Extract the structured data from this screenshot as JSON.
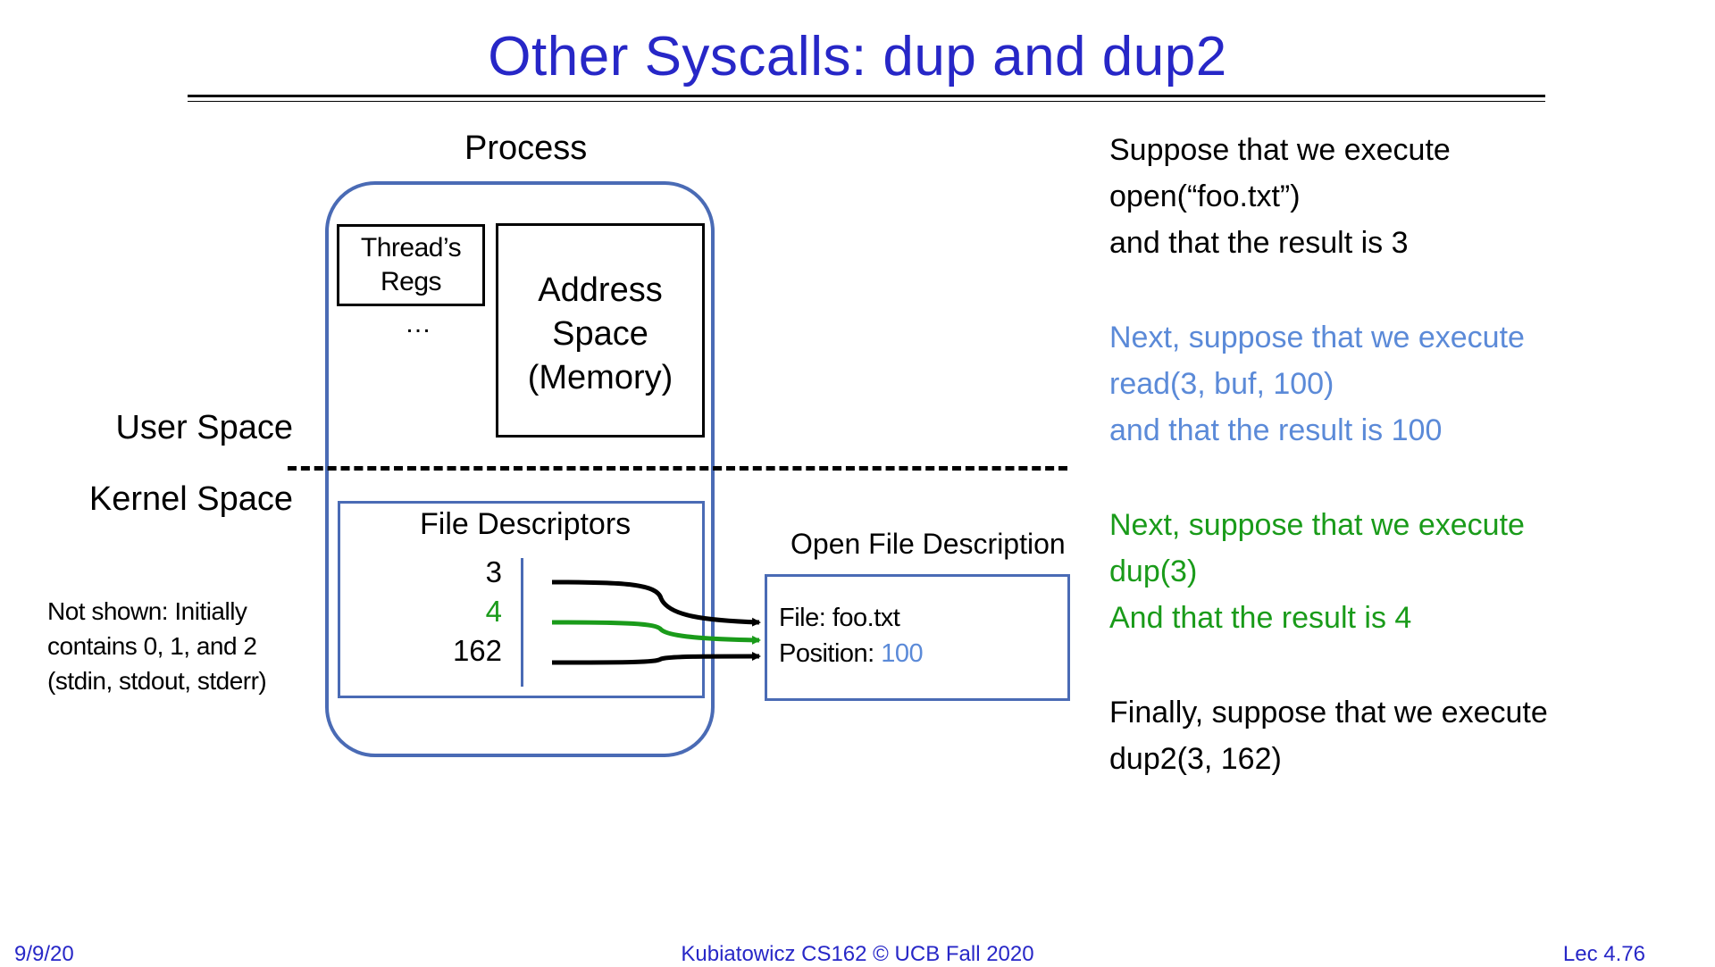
{
  "title": "Other Syscalls: dup and dup2",
  "diagram": {
    "process_label": "Process",
    "user_space_label": "User Space",
    "kernel_space_label": "Kernel Space",
    "threads_regs": [
      "Thread’s",
      "Regs"
    ],
    "threads_ellipsis": "…",
    "address_space": [
      "Address",
      "Space",
      "(Memory)"
    ],
    "file_descriptors_title": "File Descriptors",
    "fd_numbers": [
      "3",
      "4",
      "162"
    ],
    "open_file_description_title": "Open File Description",
    "file_label": "File: foo.txt",
    "position_label": "Position: ",
    "position_value": "100",
    "not_shown_note": [
      "Not shown: Initially",
      "contains 0, 1, and 2",
      "(stdin, stdout, stderr)"
    ],
    "colors": {
      "title": "#2727c7",
      "box_border": "#4a6bb5",
      "read_step": "#5b8ad8",
      "dup_step": "#1a9b1a",
      "arrow_default": "#000000"
    }
  },
  "steps": [
    {
      "lines": [
        "Suppose that we execute",
        "open(“foo.txt”)",
        "and that the result is 3"
      ]
    },
    {
      "lines": [
        "Next, suppose that we execute",
        "read(3, buf, 100)",
        "and that the result is 100"
      ]
    },
    {
      "lines": [
        "Next, suppose that we execute",
        "dup(3)",
        "And that the result is 4"
      ]
    },
    {
      "lines": [
        "Finally, suppose that we execute",
        "dup2(3, 162)"
      ]
    }
  ],
  "footer": {
    "date": "9/9/20",
    "center": "Kubiatowicz CS162 © UCB Fall 2020",
    "lecture": "Lec 4.76"
  }
}
